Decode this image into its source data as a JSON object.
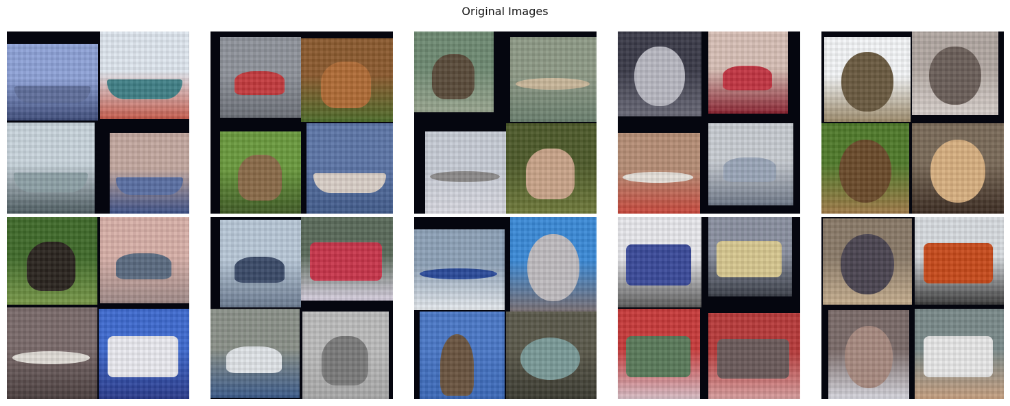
{
  "figure": {
    "title": "Original Images"
  },
  "palette": {
    "panel_background": "#05060f"
  },
  "panels": [
    {
      "tiles": [
        {
          "subject": "ship",
          "colors": [
            "#8ea2d8",
            "#5f6e9b",
            "#3e4c7a"
          ]
        },
        {
          "subject": "ship",
          "colors": [
            "#dfe7ef",
            "#3f7f86",
            "#c65a4a"
          ]
        },
        {
          "subject": "ship",
          "colors": [
            "#c9d5dd",
            "#8da0a6",
            "#4b5a5f"
          ]
        },
        {
          "subject": "ship",
          "colors": [
            "#c4a9a0",
            "#5a6fa3",
            "#3b4f86"
          ]
        }
      ]
    },
    {
      "tiles": [
        {
          "subject": "car",
          "colors": [
            "#8f939b",
            "#c43a3d",
            "#6b6f77"
          ]
        },
        {
          "subject": "deer",
          "colors": [
            "#8b5a2e",
            "#b06b35",
            "#4d6b2a"
          ]
        },
        {
          "subject": "deer",
          "colors": [
            "#6a9a3d",
            "#8a6a48",
            "#3f5a25"
          ]
        },
        {
          "subject": "ship",
          "colors": [
            "#5d76a8",
            "#d9cfc7",
            "#405a8a"
          ]
        }
      ]
    },
    {
      "tiles": [
        {
          "subject": "deer",
          "colors": [
            "#6e8a72",
            "#5a4b3a",
            "#9aa690"
          ]
        },
        {
          "subject": "airplane",
          "colors": [
            "#8e9a86",
            "#c9b79a",
            "#6a7f6e"
          ]
        },
        {
          "subject": "airplane",
          "colors": [
            "#c7ccd6",
            "#8c8a8a",
            "#d8d8e0"
          ]
        },
        {
          "subject": "deer",
          "colors": [
            "#4d5a2a",
            "#c9a489",
            "#6f7a3a"
          ]
        }
      ]
    },
    {
      "tiles": [
        {
          "subject": "dog",
          "colors": [
            "#3a3a48",
            "#b8b8c2",
            "#6a6a78"
          ]
        },
        {
          "subject": "car",
          "colors": [
            "#d8c0b6",
            "#c33442",
            "#8a2230"
          ]
        },
        {
          "subject": "airplane",
          "colors": [
            "#b68e76",
            "#e6e0da",
            "#c8463a"
          ]
        },
        {
          "subject": "car",
          "colors": [
            "#c8ccd2",
            "#9aa6b8",
            "#6e7888"
          ]
        }
      ]
    },
    {
      "tiles": [
        {
          "subject": "cat",
          "colors": [
            "#f4f6f8",
            "#6a5a40",
            "#9c8a6a"
          ]
        },
        {
          "subject": "dog",
          "colors": [
            "#b2a8a2",
            "#6a5e58",
            "#d8d0cc"
          ]
        },
        {
          "subject": "dog",
          "colors": [
            "#4f7a2a",
            "#6a4a2a",
            "#a07a48"
          ]
        },
        {
          "subject": "dog",
          "colors": [
            "#7a6a58",
            "#d8b080",
            "#3a2a20"
          ]
        }
      ]
    },
    {
      "tiles": [
        {
          "subject": "horse",
          "colors": [
            "#3f6a2a",
            "#2a241e",
            "#7a9a4a"
          ]
        },
        {
          "subject": "car",
          "colors": [
            "#d8b0a8",
            "#5a6a80",
            "#a08a88"
          ]
        },
        {
          "subject": "airplane",
          "colors": [
            "#7a6a6a",
            "#e0dcd6",
            "#4a3e3e"
          ]
        },
        {
          "subject": "truck",
          "colors": [
            "#3e6ad0",
            "#eaeaf0",
            "#2a3a8a"
          ]
        }
      ]
    },
    {
      "tiles": [
        {
          "subject": "car",
          "colors": [
            "#b8c8d8",
            "#3a4a68",
            "#6a7a90"
          ]
        },
        {
          "subject": "truck",
          "colors": [
            "#5a6a5a",
            "#c8344a",
            "#d8d0e0"
          ]
        },
        {
          "subject": "car",
          "colors": [
            "#8a9088",
            "#e0e4e8",
            "#3a5a8a"
          ]
        },
        {
          "subject": "horse",
          "colors": [
            "#bcbcbc",
            "#7a7a7a",
            "#a8a8a8"
          ]
        }
      ]
    },
    {
      "tiles": [
        {
          "subject": "airplane",
          "colors": [
            "#8ea2b8",
            "#2a4a9a",
            "#e8ecf0"
          ]
        },
        {
          "subject": "cat",
          "colors": [
            "#3a8ad8",
            "#c0bcc0",
            "#7a6e70"
          ]
        },
        {
          "subject": "bird",
          "colors": [
            "#4a78c8",
            "#6a5440",
            "#3a68b8"
          ]
        },
        {
          "subject": "frog",
          "colors": [
            "#5a584a",
            "#7a9a98",
            "#3a3a30"
          ]
        }
      ]
    },
    {
      "tiles": [
        {
          "subject": "truck",
          "colors": [
            "#e8e8ec",
            "#3a4a9a",
            "#5a5a5a"
          ]
        },
        {
          "subject": "truck",
          "colors": [
            "#8a90a0",
            "#d8c890",
            "#3a3e48"
          ]
        },
        {
          "subject": "truck",
          "colors": [
            "#c83a3a",
            "#5a7a5a",
            "#d8c0c8"
          ]
        },
        {
          "subject": "truck",
          "colors": [
            "#b83a3a",
            "#6a5a5a",
            "#d8a0a0"
          ]
        }
      ]
    },
    {
      "tiles": [
        {
          "subject": "dog",
          "colors": [
            "#8a7a68",
            "#4a4450",
            "#c8b090"
          ]
        },
        {
          "subject": "truck",
          "colors": [
            "#d8dce0",
            "#c84a1a",
            "#3a3a3a"
          ]
        },
        {
          "subject": "dog",
          "colors": [
            "#7a6a68",
            "#a88a80",
            "#d8d8e0"
          ]
        },
        {
          "subject": "truck",
          "colors": [
            "#7a8a8a",
            "#e8e8e8",
            "#c8a080"
          ]
        }
      ]
    }
  ]
}
